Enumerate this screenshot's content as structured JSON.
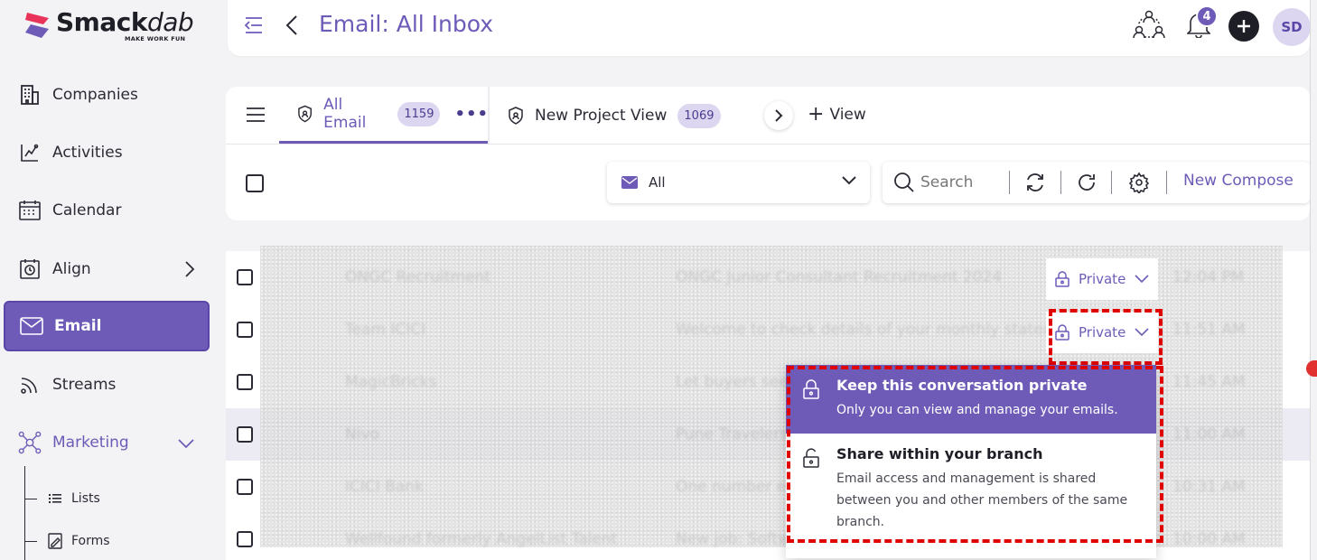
{
  "brand": {
    "name_main": "Smack",
    "name_script": "dab",
    "tagline": "MAKE WORK FUN",
    "accent": "#6e5bb8"
  },
  "sidebar": {
    "items": [
      {
        "label": "Companies",
        "icon": "building-icon"
      },
      {
        "label": "Activities",
        "icon": "activities-icon"
      },
      {
        "label": "Calendar",
        "icon": "calendar-icon"
      },
      {
        "label": "Align",
        "icon": "align-icon"
      },
      {
        "label": "Email",
        "icon": "envelope-icon",
        "active": true
      },
      {
        "label": "Streams",
        "icon": "streams-icon"
      },
      {
        "label": "Marketing",
        "icon": "marketing-icon"
      }
    ],
    "sub_items": [
      {
        "label": "Lists",
        "icon": "list-icon"
      },
      {
        "label": "Forms",
        "icon": "form-icon"
      }
    ]
  },
  "header": {
    "title": "Email: All Inbox",
    "notification_count": "4",
    "avatar_initials": "SD"
  },
  "tabs": [
    {
      "label": "All Email",
      "count": "1159",
      "active": true
    },
    {
      "label": "New  Project View",
      "count": "1069"
    }
  ],
  "add_view_label": "View",
  "toolbar": {
    "folder_value": "All",
    "search_placeholder": "Search",
    "compose_label": "New Compose"
  },
  "emails": [
    {
      "sender": "ONGC Recruitment",
      "subject": "ONGC Junior Consultant Recruitment 2024",
      "time": "12:04 PM",
      "privacy": "Private"
    },
    {
      "sender": "Team ICICI",
      "subject": "Welcome to check details of your monthly statement",
      "time": "11:51 AM",
      "privacy": "Private"
    },
    {
      "sender": "MagicBricks",
      "subject": "Let buyers see your property",
      "time": "11:45 AM",
      "privacy": ""
    },
    {
      "sender": "Nivo",
      "subject": "Pune Travelers Offer",
      "time": "11:00 AM",
      "privacy": ""
    },
    {
      "sender": "ICICI Bank",
      "subject": "One number every",
      "time": "10:31 AM",
      "privacy": ""
    },
    {
      "sender": "Wellfound formerly AngelList Talent",
      "subject": "New job: Software",
      "time": "10:00 AM",
      "privacy": ""
    }
  ],
  "privacy_menu": {
    "options": [
      {
        "title": "Keep this conversation private",
        "description": "Only you can view and manage your emails.",
        "selected": true
      },
      {
        "title": "Share within your branch",
        "description": "Email access and management is shared between you and other members of the same branch.",
        "selected": false
      }
    ]
  }
}
